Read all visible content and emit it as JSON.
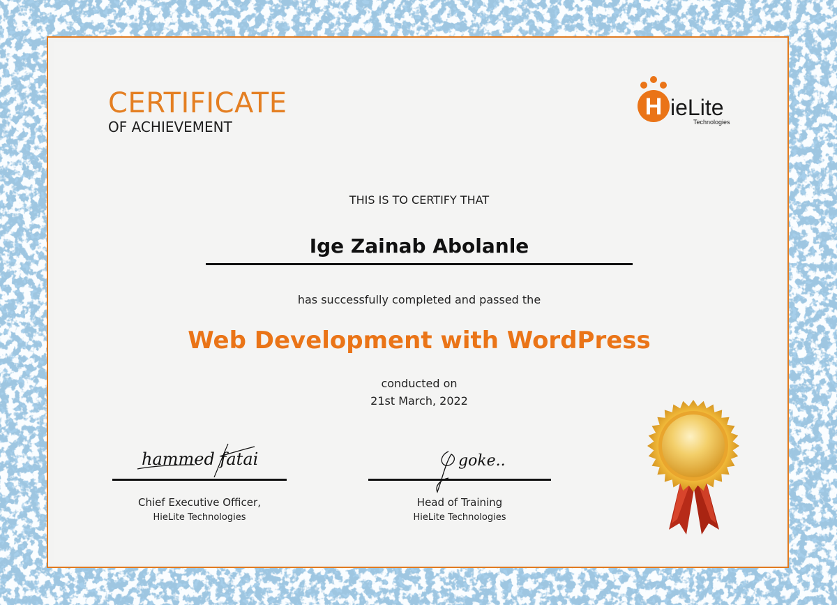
{
  "certificate": {
    "title": "CERTIFICATE",
    "subtitle": "OF ACHIEVEMENT",
    "certify_text": "THIS IS TO CERTIFY THAT",
    "recipient_name": "Ige Zainab Abolanle",
    "completed_text": "has successfully completed and passed the",
    "course_title": "Web Development with WordPress",
    "conducted_label": "conducted on",
    "date": "21st March, 2022"
  },
  "logo": {
    "brand_initial": "H",
    "brand_rest": "ieLite",
    "tagline": "Technologies"
  },
  "signatures": [
    {
      "signature_text": "hammed fatai",
      "role": "Chief Executive Officer,",
      "organization": "HieLite Technologies"
    },
    {
      "signature_text": "goke..",
      "role": "Head of Training",
      "organization": "HieLite Technologies"
    }
  ],
  "colors": {
    "accent": "#e47f22",
    "course_title": "#ea7417",
    "border": "#e07a1f",
    "background_pattern": "#9cc6e2",
    "seal_gold": "#e8b640",
    "ribbon_red": "#c8321d"
  }
}
